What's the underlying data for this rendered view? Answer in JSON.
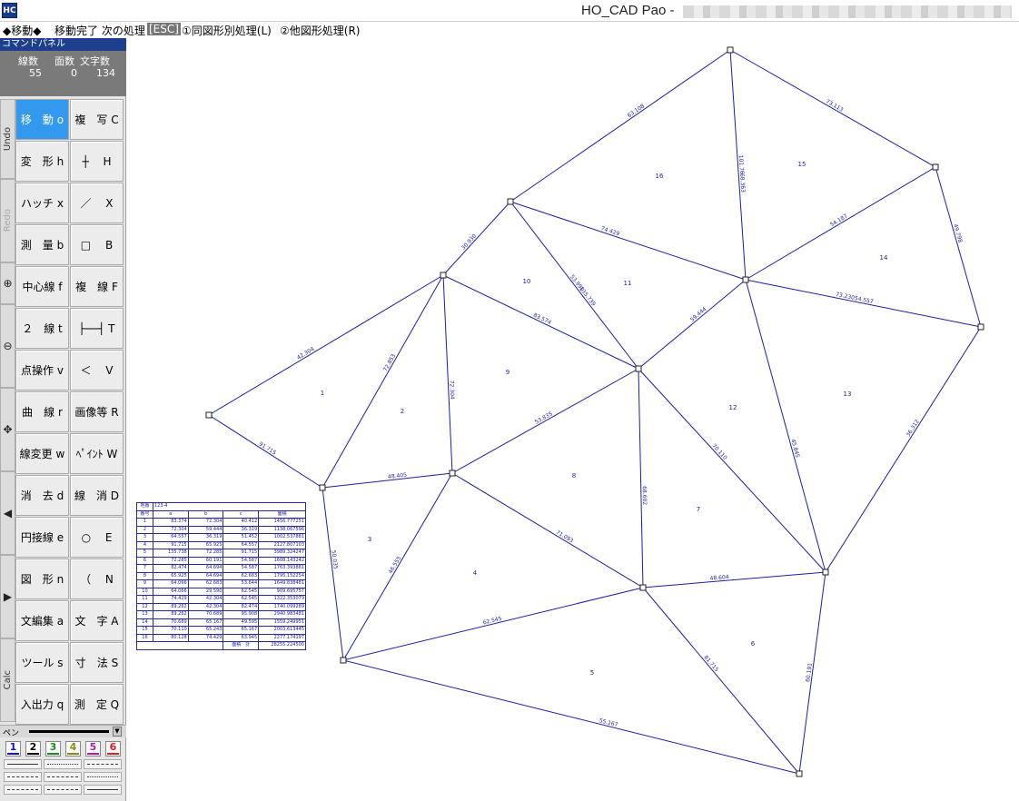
{
  "title": {
    "icon_text": "HC",
    "app_name": "HO_CAD Pao -"
  },
  "status": {
    "mode": "◆移動◆",
    "message": "移動完了 次の処理",
    "esc": "[ESC]",
    "option1": "①同図形別処理(L)",
    "option2": "②他図形処理(R)"
  },
  "panel": {
    "header": "コマンドパネル",
    "counts": {
      "line_label": "線数",
      "line_value": "55",
      "face_label": "面数",
      "face_value": "0",
      "char_label": "文字数",
      "char_value": "134"
    },
    "side_tabs": [
      "Undo",
      "Redo",
      "Calc"
    ],
    "buttons_left": [
      "移　動 o",
      "変　形 h",
      "ハッチ x",
      "測　量 b",
      "中心線 f",
      "２　線 t",
      "点操作 v",
      "曲　線 r",
      "線変更 w",
      "消　去 d",
      "円接線 e",
      "図　形 n",
      "文編集 a",
      "ツール s",
      "入出力 q"
    ],
    "buttons_right": [
      "複　写 C",
      "┼　 H",
      "／　 X",
      "□　 B",
      "複　線 F",
      "├──┤ T",
      "＜　 V",
      "画像等 R",
      "ﾍﾟｲﾝﾄ W",
      "線　消 D",
      "○　 E",
      "（　 N",
      "文　字 A",
      "寸　法 S",
      "測　定 Q"
    ],
    "pen_label": "ペン",
    "pen_numbers": [
      "1",
      "2",
      "3",
      "4",
      "5",
      "6"
    ],
    "pen_colors": [
      "#1414c8",
      "#000000",
      "#1a8a1a",
      "#8a8a10",
      "#b01ab0",
      "#e02020"
    ]
  },
  "drawing": {
    "edge_labels": [
      "63.108",
      "73.113",
      "68.363",
      "49.798",
      "54.187",
      "30.930",
      "74.429",
      "53.990",
      "42.304",
      "72.853",
      "83.574",
      "72.304",
      "59.444",
      "54.557",
      "45.845",
      "36.312",
      "53.835",
      "68.602",
      "70.110",
      "91.715",
      "48.405",
      "50.035",
      "46.555",
      "71.093",
      "48.604",
      "62.545",
      "55.167",
      "81.715",
      "60.191",
      "135.739",
      "73.230",
      "101.76"
    ],
    "face_labels": [
      "1",
      "2",
      "3",
      "4",
      "5",
      "6",
      "7",
      "8",
      "9",
      "10",
      "11",
      "12",
      "13",
      "14",
      "15",
      "16"
    ]
  },
  "table": {
    "header_label": "地番",
    "header_value": "123-4",
    "columns": [
      "番号",
      "a",
      "b",
      "c",
      "面積"
    ],
    "rows": [
      [
        "1",
        "83.374",
        "72.304",
        "40.412",
        "1456.777251"
      ],
      [
        "2",
        "72.304",
        "59.444",
        "36.319",
        "1138.067596"
      ],
      [
        "3",
        "64.557",
        "36.319",
        "51.452",
        "1002.537881"
      ],
      [
        "4",
        "91.715",
        "65.925",
        "64.557",
        "2127.807103"
      ],
      [
        "5",
        "135.738",
        "72.285",
        "91.715",
        "3989.324247"
      ],
      [
        "6",
        "72.285",
        "60.191",
        "54.587",
        "1608.143242"
      ],
      [
        "7",
        "82.474",
        "64.694",
        "54.587",
        "1763.393881"
      ],
      [
        "8",
        "65.925",
        "64.694",
        "62.683",
        "1795.152254"
      ],
      [
        "9",
        "64.066",
        "62.683",
        "53.644",
        "1649.838481"
      ],
      [
        "10",
        "64.066",
        "29.590",
        "62.545",
        "909.695757"
      ],
      [
        "11",
        "74.429",
        "42.304",
        "62.545",
        "1322.353079"
      ],
      [
        "12",
        "89.262",
        "42.304",
        "82.474",
        "1740.099289"
      ],
      [
        "13",
        "89.262",
        "70.689",
        "95.908",
        "2940.983481"
      ],
      [
        "14",
        "70.689",
        "65.167",
        "49.595",
        "1559.249951"
      ],
      [
        "15",
        "70.110",
        "65.243",
        "65.167",
        "2003.613445"
      ],
      [
        "16",
        "80.128",
        "74.429",
        "63.945",
        "2277.174197"
      ]
    ],
    "total_label": "面積　計",
    "total_value": "28255.224500"
  }
}
